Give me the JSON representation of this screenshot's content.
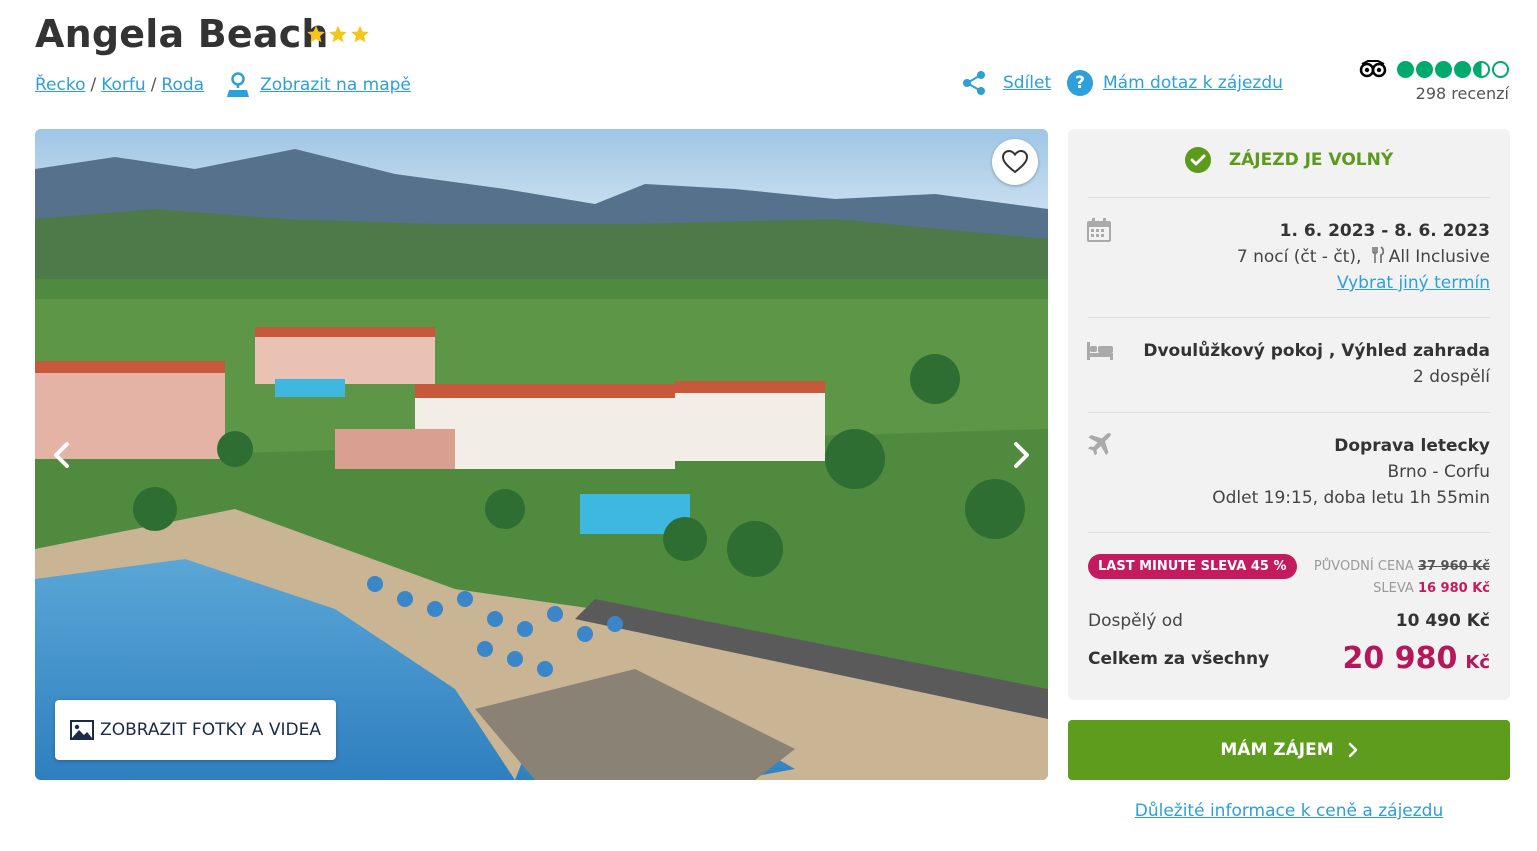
{
  "header": {
    "title": "Angela Beach",
    "stars": 3,
    "breadcrumb": [
      "Řecko",
      "Korfu",
      "Roda"
    ],
    "breadcrumb_separator": "/",
    "map_link": "Zobrazit na mapě",
    "share": "Sdílet",
    "question": "Mám dotaz k zájezdu",
    "tripadvisor_rating": 4.5,
    "reviews": "298 recenzí"
  },
  "gallery": {
    "photos_button": "ZOBRAZIT FOTKY A VIDEA"
  },
  "panel": {
    "status": "ZÁJEZD JE VOLNÝ",
    "dates": "1. 6. 2023 - 8. 6. 2023",
    "nights": "7 nocí (čt - čt),",
    "board": "All Inclusive",
    "change_term": "Vybrat jiný termín",
    "room": "Dvoulůžkový pokoj , Výhled zahrada",
    "persons": "2 dospělí",
    "transport": "Doprava letecky",
    "route": "Brno - Corfu",
    "flight": "Odlet 19:15, doba letu 1h 55min",
    "badge": "LAST MINUTE SLEVA 45 %",
    "original_label": "PŮVODNÍ CENA",
    "original_price": "37 960 Kč",
    "discount_label": "SLEVA",
    "discount_price": "16 980 Kč",
    "adult_label": "Dospělý od",
    "adult_price": "10 490 Kč",
    "total_label": "Celkem za všechny",
    "total_amount": "20 980",
    "total_currency": "Kč"
  },
  "cta": {
    "label": "MÁM ZÁJEM"
  },
  "footer": {
    "info_link": "Důležité informace k ceně a zájezdu"
  },
  "colors": {
    "link": "#2d9fd9",
    "green": "#5e9c1e",
    "discount": "#c41a5e",
    "tripadvisor": "#00aa6c",
    "star": "#f5c518"
  }
}
